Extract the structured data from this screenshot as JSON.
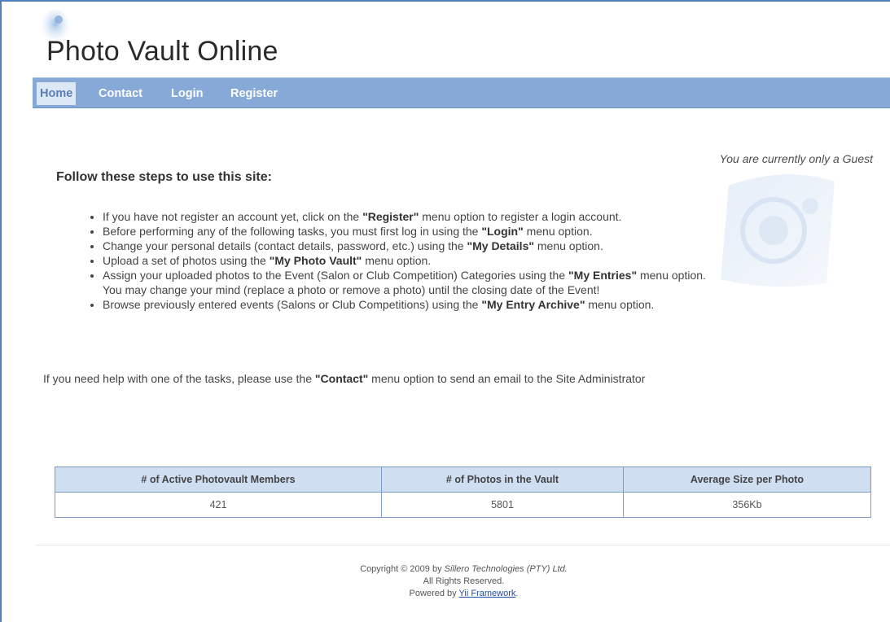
{
  "header": {
    "title": "Photo Vault Online"
  },
  "nav": {
    "items": [
      {
        "label": "Home"
      },
      {
        "label": "Contact"
      },
      {
        "label": "Login"
      },
      {
        "label": "Register"
      }
    ],
    "active": "Home"
  },
  "main": {
    "guest_note": "You are currently only a Guest",
    "steps_heading": "Follow these steps to use this site:",
    "steps": [
      {
        "pre": "If you have not register an account yet, click on the ",
        "bold": "\"Register\"",
        "post": " menu option to register a login account."
      },
      {
        "pre": "Before performing any of the following tasks, you must first log in using the ",
        "bold": "\"Login\"",
        "post": " menu option."
      },
      {
        "pre": "Change your personal details (contact details, password, etc.) using the ",
        "bold": "\"My Details\"",
        "post": " menu option."
      },
      {
        "pre": "Upload a set of photos using the ",
        "bold": "\"My Photo Vault\"",
        "post": " menu option."
      },
      {
        "pre": "Assign your uploaded photos to the Event (Salon or Club Competition) Categories using the ",
        "bold": "\"My Entries\"",
        "post": " menu option.",
        "note": "You may change your mind (replace a photo or remove a photo) until the closing date of the Event!"
      },
      {
        "pre": "Browse previously entered events (Salons or Club Competitions) using the ",
        "bold": "\"My Entry Archive\"",
        "post": " menu option."
      }
    ],
    "help": {
      "pre": "If you need help with one of the tasks, please use the ",
      "bold": "\"Contact\"",
      "post": " menu option to send an email to the Site Administrator"
    }
  },
  "stats": {
    "headers": [
      "# of Active Photovault Members",
      "# of Photos in the Vault",
      "Average Size per Photo"
    ],
    "values": [
      "421",
      "5801",
      "356Kb"
    ]
  },
  "footer": {
    "copyright_pre": "Copyright © 2009 by ",
    "company": "Sillero Technologies (PTY) Ltd.",
    "rights": "All Rights Reserved.",
    "powered_pre": "Powered by ",
    "powered_link": "Yii Framework",
    "powered_post": "."
  },
  "colors": {
    "nav_background": "#86a9d7",
    "nav_active_background": "#dde8f6",
    "table_header_background": "#cfdef1",
    "link": "#1d4fa8"
  },
  "icons": {
    "logo": "camera-lens-swirl-icon",
    "watermark": "camera-watermark-icon"
  }
}
